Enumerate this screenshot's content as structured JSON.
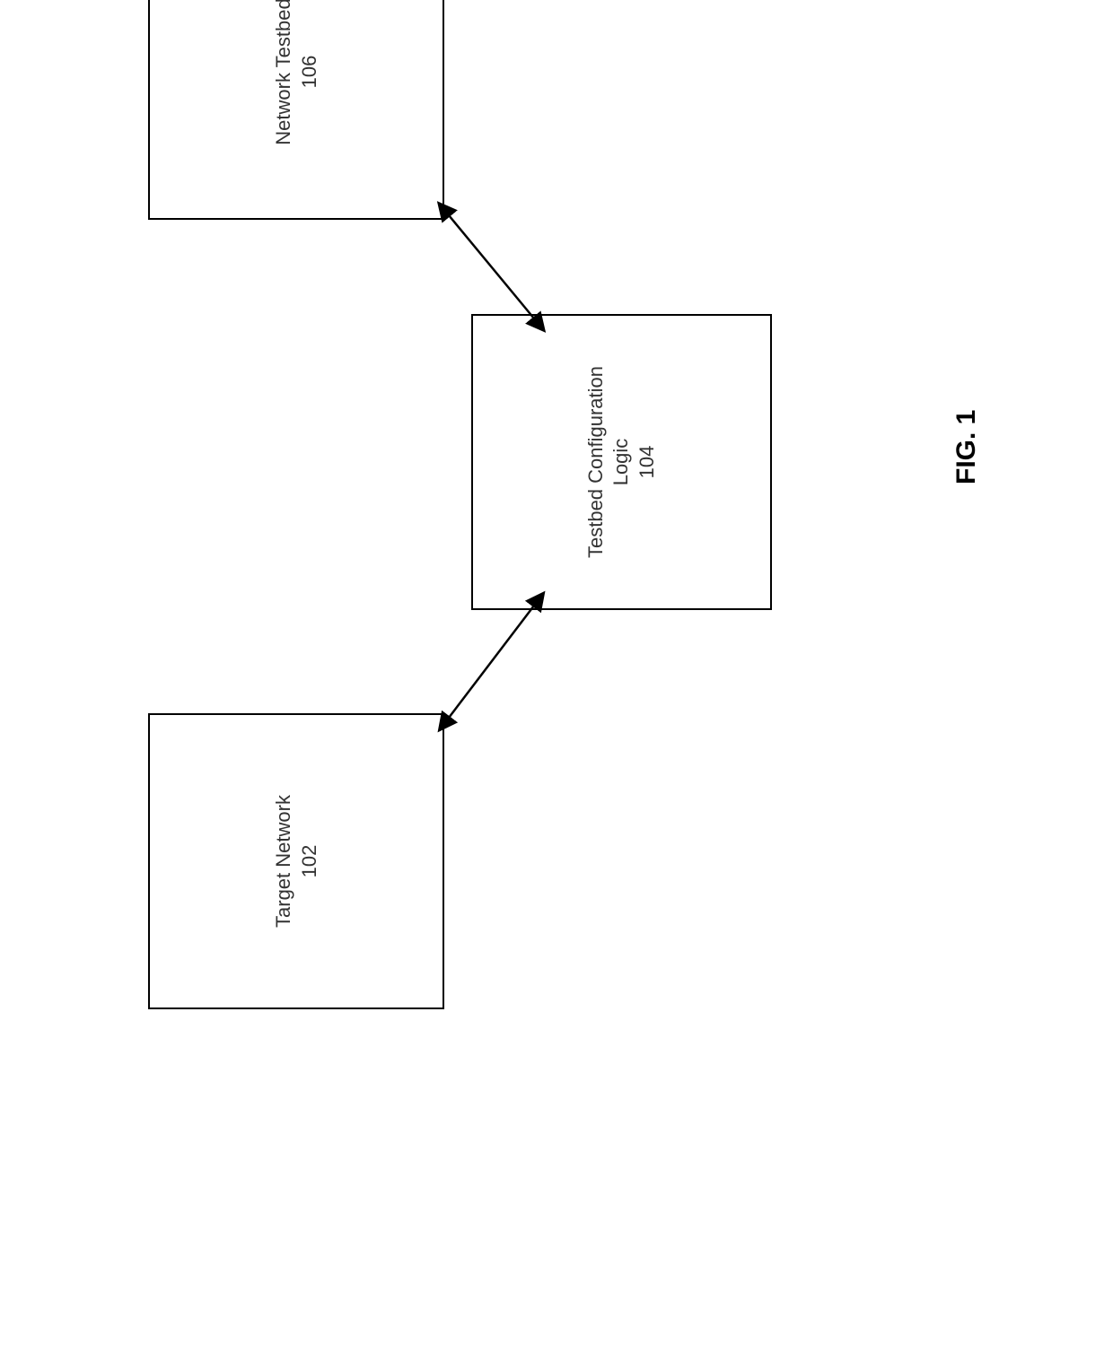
{
  "nodes": {
    "target_network": {
      "label": "Target Network",
      "ref": "102"
    },
    "testbed_config": {
      "label": "Testbed Configuration Logic",
      "ref": "104"
    },
    "network_testbed": {
      "label": "Network Testbed",
      "ref": "106"
    }
  },
  "figure_label": "FIG. 1"
}
